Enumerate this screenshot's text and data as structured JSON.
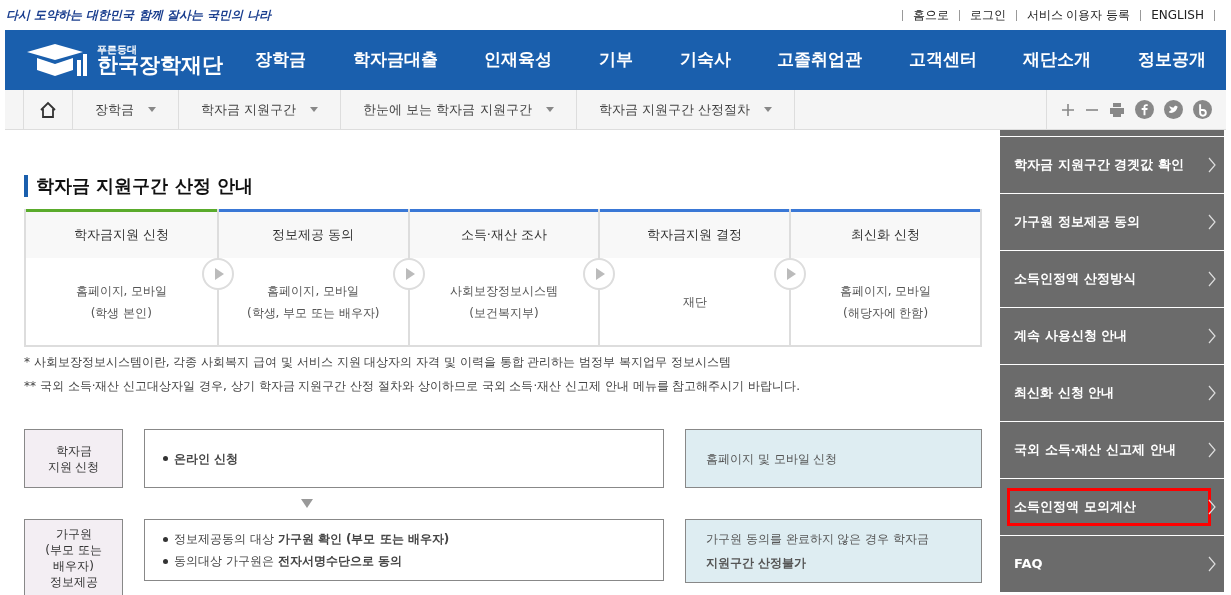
{
  "slogan": "다시 도약하는 대한민국 함께 잘사는 국민의 나라",
  "util_links": [
    "홈으로",
    "로그인",
    "서비스 이용자 등록",
    "ENGLISH"
  ],
  "logo": {
    "subtitle": "푸른등대",
    "title": "한국장학재단"
  },
  "nav": [
    "장학금",
    "학자금대출",
    "인재육성",
    "기부",
    "기숙사",
    "고졸취업관",
    "고객센터",
    "재단소개",
    "정보공개"
  ],
  "breadcrumb": [
    "장학금",
    "학자금 지원구간",
    "한눈에 보는 학자금 지원구간",
    "학자금 지원구간 산정절차"
  ],
  "section_title": "학자금 지원구간 산정 안내",
  "steps": [
    {
      "title": "학자금지원 신청",
      "lines": [
        "홈페이지, 모바일",
        "(학생 본인)"
      ],
      "color": "#5aab2c"
    },
    {
      "title": "정보제공 동의",
      "lines": [
        "홈페이지, 모바일",
        "(학생, 부모 또는 배우자)"
      ],
      "color": "#3a78d6"
    },
    {
      "title": "소득·재산 조사",
      "lines": [
        "사회보장정보시스템",
        "(보건복지부)"
      ],
      "color": "#3a78d6"
    },
    {
      "title": "학자금지원 결정",
      "lines": [
        "재단"
      ],
      "color": "#3a78d6"
    },
    {
      "title": "최신화 신청",
      "lines": [
        "홈페이지, 모바일",
        "(해당자에 한함)"
      ],
      "color": "#3a78d6"
    }
  ],
  "notes": [
    "* 사회보장정보시스템이란, 각종 사회복지 급여 및 서비스 지원 대상자의 자격 및 이력을 통합 관리하는 범정부 복지업무 정보시스템",
    "** 국외 소득·재산 신고대상자일 경우, 상기 학자금 지원구간 산정 절차와 상이하므로 국외 소득·재산 신고제 안내 메뉴를 참고해주시기 바랍니다."
  ],
  "flow": [
    {
      "label": [
        "학자금",
        "지원 신청"
      ],
      "bullets": [
        "**온라인 신청**"
      ],
      "info": [
        "홈페이지 및 모바일 신청"
      ]
    },
    {
      "label": [
        "가구원",
        "(부모 또는",
        "배우자)",
        "정보제공"
      ],
      "bullets": [
        "정보제공동의 대상 **가구원 확인 (부모 또는 배우자)**",
        "동의대상 가구원은 **전자서명수단으로 동의**"
      ],
      "info": [
        "가구원 동의를 완료하지 않은 경우 학자금",
        "**지원구간 산정불가**"
      ]
    }
  ],
  "sidebar": [
    {
      "label": "학자금 지원구간 경곗값 확인",
      "highlighted": false
    },
    {
      "label": "가구원 정보제공 동의",
      "highlighted": false
    },
    {
      "label": "소득인정액 산정방식",
      "highlighted": false
    },
    {
      "label": "계속 사용신청 안내",
      "highlighted": false
    },
    {
      "label": "최신화 신청 안내",
      "highlighted": false
    },
    {
      "label": "국외 소득·재산 신고제 안내",
      "highlighted": false
    },
    {
      "label": "소득인정액 모의계산",
      "highlighted": true
    },
    {
      "label": "FAQ",
      "highlighted": false
    }
  ]
}
